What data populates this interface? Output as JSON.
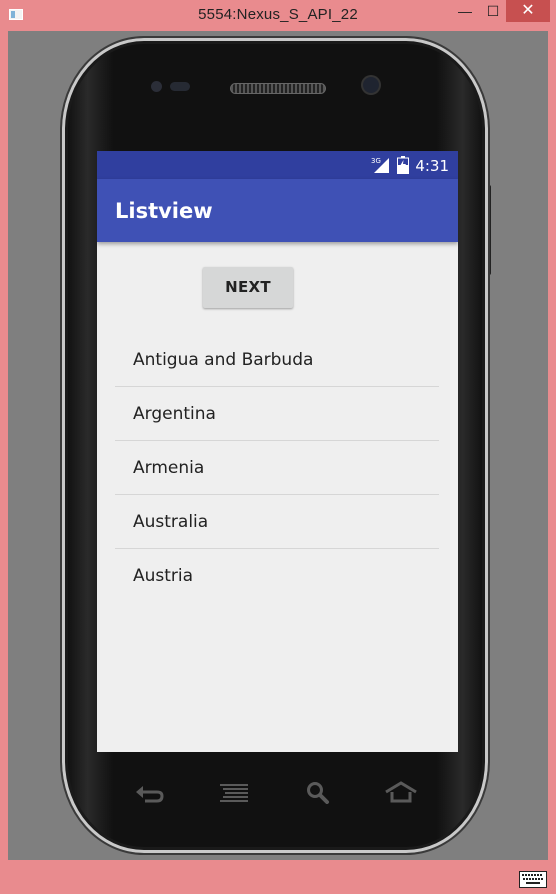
{
  "window": {
    "title": "5554:Nexus_S_API_22",
    "minimize_glyph": "—",
    "maximize_glyph": "☐",
    "close_glyph": "✕"
  },
  "statusbar": {
    "network": "3G",
    "time": "4:31"
  },
  "appbar": {
    "title": "Listview"
  },
  "next_button": {
    "label": "NEXT"
  },
  "countries": [
    "Antigua and Barbuda",
    "Argentina",
    "Armenia",
    "Australia",
    "Austria"
  ],
  "nav": {
    "keys": [
      "back-icon",
      "menu-icon",
      "search-icon",
      "home-icon"
    ]
  },
  "colors": {
    "statusbar": "#303f9f",
    "appbar": "#3f51b5",
    "screen_bg": "#efefef",
    "window_frame": "#e98b8e"
  }
}
